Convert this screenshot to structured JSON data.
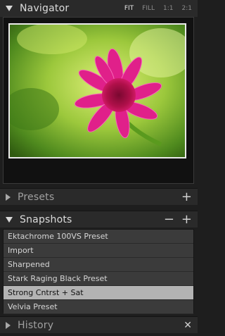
{
  "navigator": {
    "title": "Navigator",
    "zoom_options": [
      {
        "label": "FIT",
        "selected": true
      },
      {
        "label": "FILL",
        "selected": false
      },
      {
        "label": "1:1",
        "selected": false
      },
      {
        "label": "2:1",
        "selected": false
      }
    ]
  },
  "presets": {
    "title": "Presets",
    "add_icon": "plus-icon"
  },
  "snapshots": {
    "title": "Snapshots",
    "remove_icon": "minus-icon",
    "add_icon": "plus-icon",
    "items": [
      {
        "label": "Ektachrome 100VS Preset",
        "selected": false
      },
      {
        "label": "Import",
        "selected": false
      },
      {
        "label": "Sharpened",
        "selected": false
      },
      {
        "label": "Stark Raging Black Preset",
        "selected": false
      },
      {
        "label": "Strong Cntrst + Sat",
        "selected": true
      },
      {
        "label": "Velvia Preset",
        "selected": false
      }
    ]
  },
  "history": {
    "title": "History",
    "clear_icon": "close-icon"
  },
  "colors": {
    "panel_bg": "#2a2a2a",
    "selected_row": "#b3b3b3",
    "photo_flower": "#e0208a",
    "photo_background": "#8fbf3a"
  }
}
